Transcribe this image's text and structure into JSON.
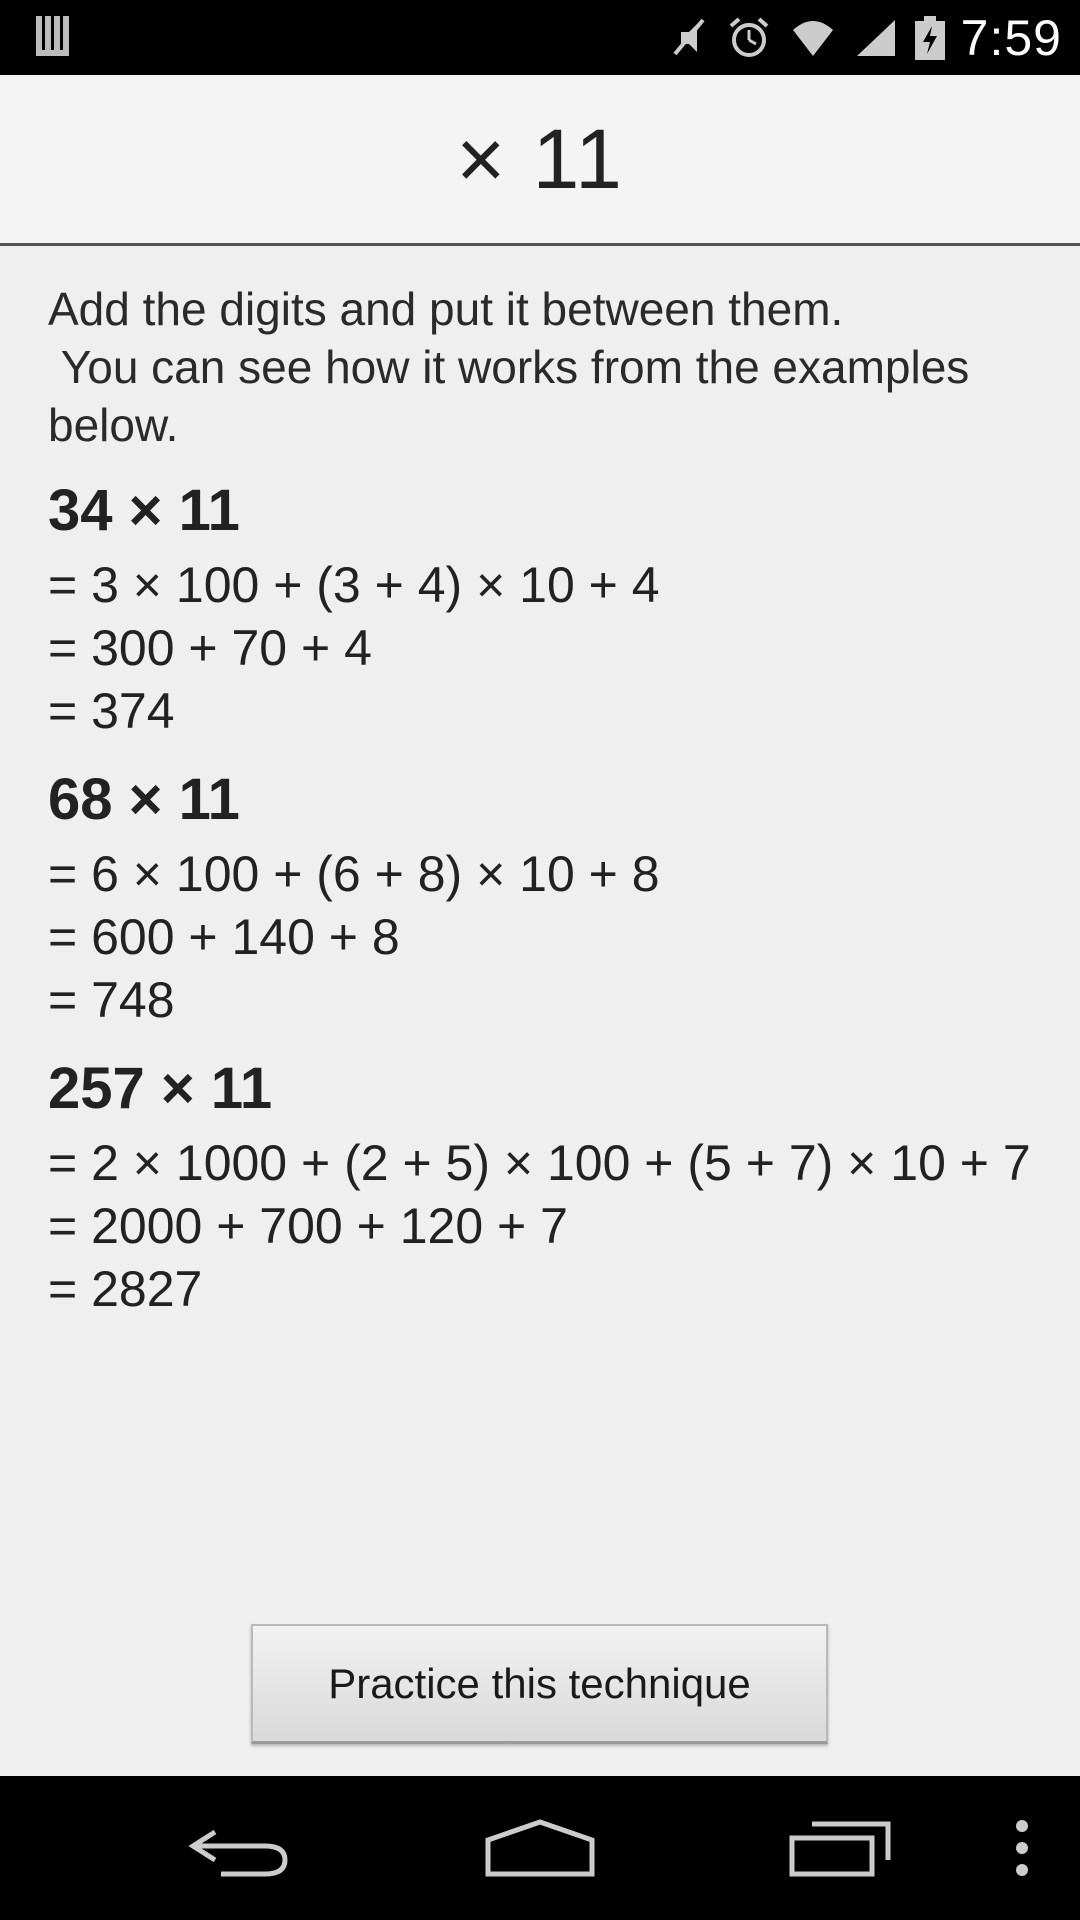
{
  "status_bar": {
    "time": "7:59",
    "icons": [
      "notification-bars-icon",
      "mute-icon",
      "alarm-icon",
      "wifi-icon",
      "signal-icon",
      "battery-charging-icon"
    ]
  },
  "header": {
    "title": "× 11"
  },
  "intro": "Add the digits and put it between them.\n You can see how it works from the examples below.",
  "examples": [
    {
      "heading": "34 × 11",
      "lines": [
        "= 3 × 100 + (3 + 4) × 10 + 4",
        "= 300 + 70 + 4",
        "= 374"
      ]
    },
    {
      "heading": "68 × 11",
      "lines": [
        "= 6 × 100 + (6 + 8) × 10 + 8",
        "= 600 + 140 + 8",
        "= 748"
      ]
    },
    {
      "heading": "257 × 11",
      "lines": [
        "= 2 × 1000 + (2 + 5) × 100 + (5 + 7) × 10 + 7",
        "= 2000 + 700 + 120 + 7",
        "= 2827"
      ]
    }
  ],
  "practice_button": {
    "label": "Practice this technique"
  },
  "nav_bar": {
    "icons": [
      "back-icon",
      "home-icon",
      "recents-icon",
      "overflow-menu-icon"
    ]
  }
}
